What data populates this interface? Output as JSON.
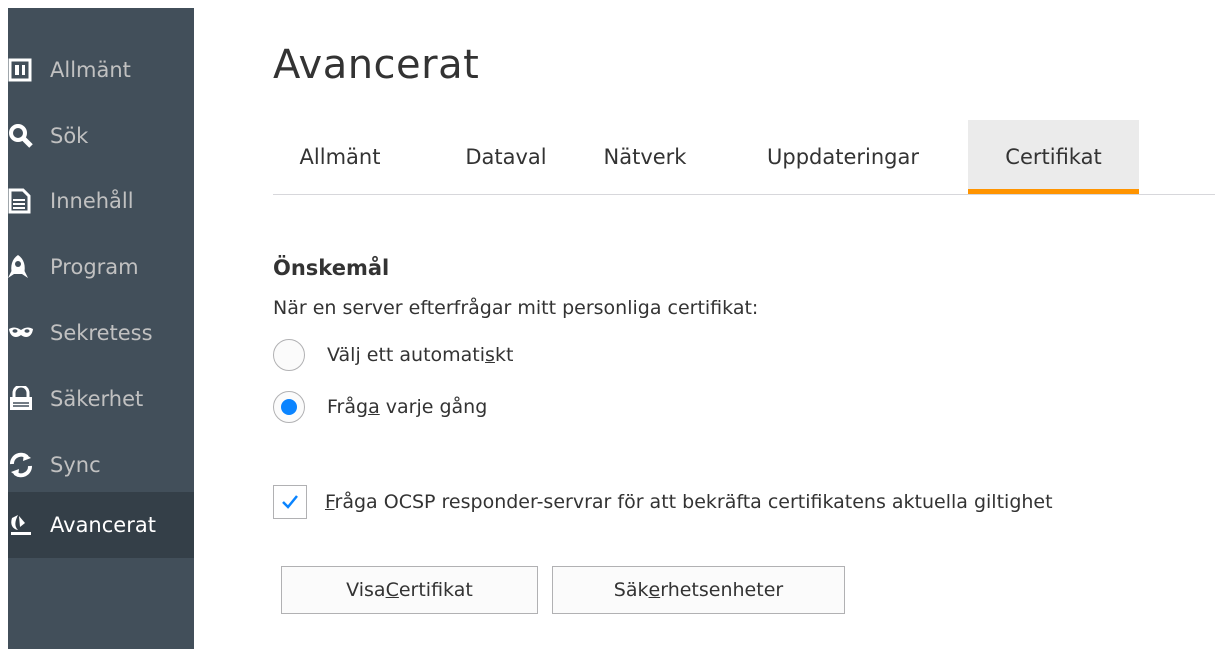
{
  "sidebar": {
    "items": [
      {
        "label": "Allmänt",
        "icon": "general-icon",
        "active": false
      },
      {
        "label": "Sök",
        "icon": "search-icon",
        "active": false
      },
      {
        "label": "Innehåll",
        "icon": "content-icon",
        "active": false
      },
      {
        "label": "Program",
        "icon": "applications-icon",
        "active": false
      },
      {
        "label": "Sekretess",
        "icon": "privacy-mask-icon",
        "active": false
      },
      {
        "label": "Säkerhet",
        "icon": "security-lock-icon",
        "active": false
      },
      {
        "label": "Sync",
        "icon": "sync-icon",
        "active": false
      },
      {
        "label": "Avancerat",
        "icon": "advanced-icon",
        "active": true
      }
    ]
  },
  "main": {
    "title": "Avancerat",
    "tabs": [
      {
        "label": "Allmänt",
        "active": false
      },
      {
        "label": "Dataval",
        "active": false
      },
      {
        "label": "Nätverk",
        "active": false
      },
      {
        "label": "Uppdateringar",
        "active": false
      },
      {
        "label": "Certifikat",
        "active": true
      }
    ],
    "section_title": "Önskemål",
    "description": "När en server efterfrågar mitt personliga certifikat:",
    "radio_options": [
      {
        "label_pre": "Välj ett automati",
        "accesskey": "s",
        "label_post": "kt",
        "selected": false
      },
      {
        "label_pre": "Fråg",
        "accesskey": "a",
        "label_post": " varje gång",
        "selected": true
      }
    ],
    "ocsp_checkbox": {
      "accesskey": "F",
      "label_post": "råga OCSP responder-servrar för att bekräfta certifikatens aktuella giltighet",
      "checked": true
    },
    "buttons": {
      "view_certs": {
        "label_pre": "Visa ",
        "accesskey": "C",
        "label_post": "ertifikat"
      },
      "security_devices": {
        "label_pre": "Säk",
        "accesskey": "e",
        "label_post": "rhetsenheter"
      }
    }
  },
  "colors": {
    "sidebar_bg": "#424f5a",
    "sidebar_active_bg": "#343f48",
    "tab_accent": "#ff9400",
    "radio_accent": "#0a84ff"
  }
}
